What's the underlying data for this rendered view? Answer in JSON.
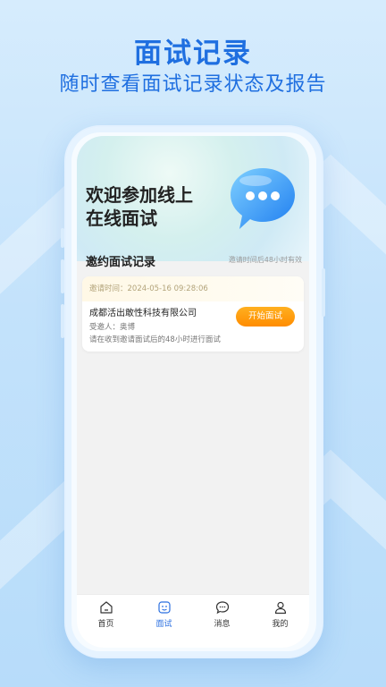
{
  "promo": {
    "title": "面试记录",
    "subtitle": "随时查看面试记录状态及报告"
  },
  "hero": {
    "line1": "欢迎参加线上",
    "line2": "在线面试",
    "icon": "chat-bubble-icon"
  },
  "section": {
    "title": "邀约面试记录",
    "note": "邀请时间后48小时有效"
  },
  "invitation": {
    "time_label": "邀请时间：2024-05-16 09:28:06",
    "company": "成都活出敢性科技有限公司",
    "invitee": "受邀人：奥博",
    "tip": "请在收到邀请面试后的48小时进行面试",
    "button": "开始面试"
  },
  "tabs": [
    {
      "label": "首页",
      "icon": "home-icon",
      "active": false
    },
    {
      "label": "面试",
      "icon": "interview-face-icon",
      "active": true
    },
    {
      "label": "消息",
      "icon": "message-icon",
      "active": false
    },
    {
      "label": "我的",
      "icon": "profile-icon",
      "active": false
    }
  ],
  "colors": {
    "brand": "#1f6fe0",
    "accent_orange": "#ff8c00",
    "tab_active": "#2a6fe0"
  }
}
